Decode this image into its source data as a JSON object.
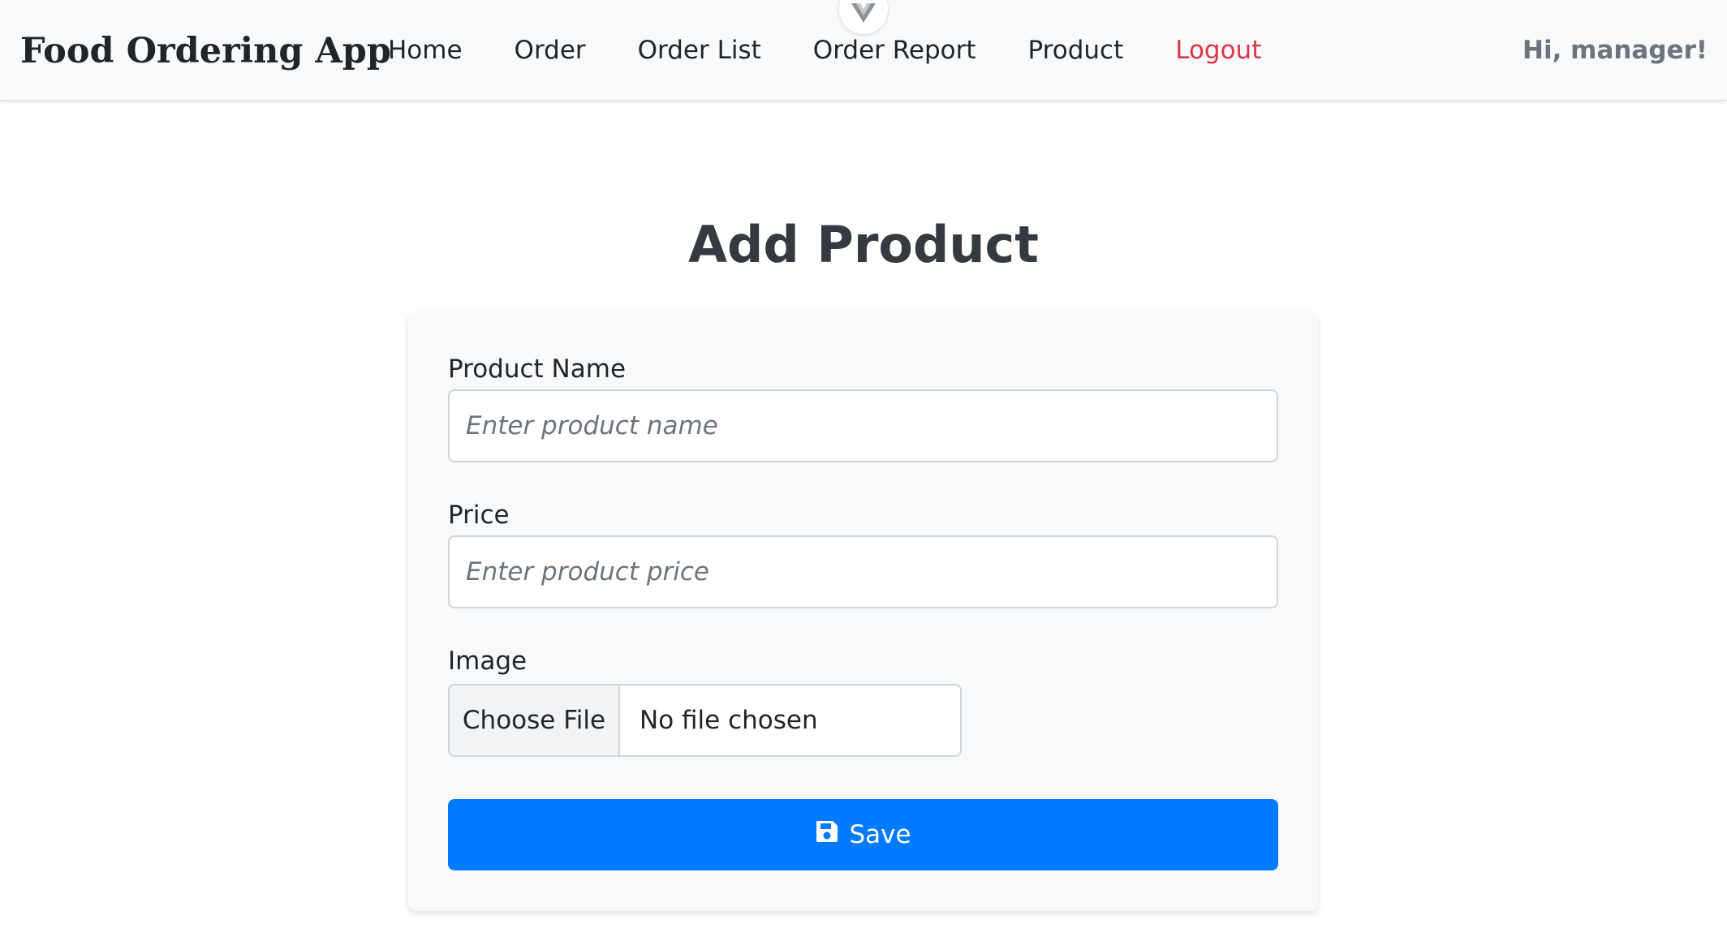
{
  "navbar": {
    "brand": "Food Ordering App",
    "links": [
      {
        "label": "Home"
      },
      {
        "label": "Order"
      },
      {
        "label": "Order List"
      },
      {
        "label": "Order Report"
      },
      {
        "label": "Product"
      },
      {
        "label": "Logout",
        "color": "#dc3545"
      }
    ],
    "greeting": "Hi, manager!",
    "devtools_icon": "vue-logo-icon"
  },
  "page": {
    "title": "Add Product"
  },
  "form": {
    "product_name": {
      "label": "Product Name",
      "value": "",
      "placeholder": "Enter product name"
    },
    "price": {
      "label": "Price",
      "value": "",
      "placeholder": "Enter product price"
    },
    "image": {
      "label": "Image",
      "button_label": "Choose File",
      "status": "No file chosen"
    },
    "save": {
      "label": "Save",
      "icon": "floppy-disk-icon",
      "color": "#007bff"
    }
  }
}
